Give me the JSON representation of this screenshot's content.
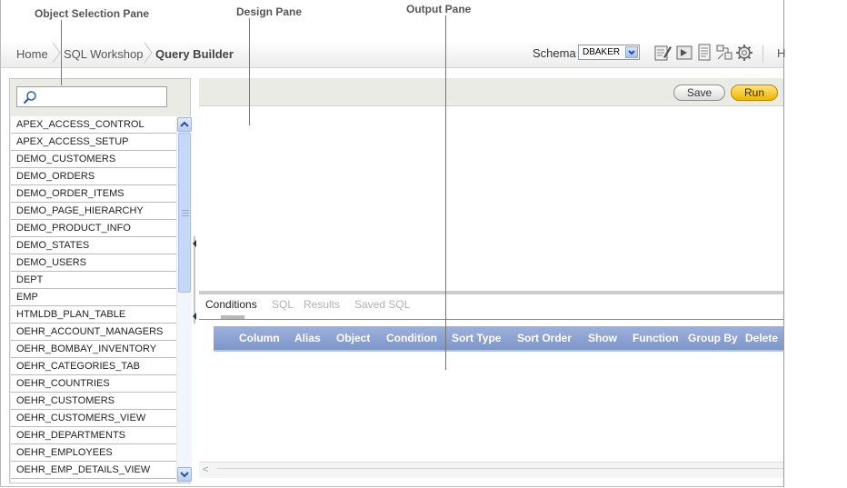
{
  "callouts": {
    "object_selection": "Object Selection Pane",
    "design": "Design Pane",
    "output": "Output Pane"
  },
  "breadcrumb": {
    "home": "Home",
    "sql_workshop": "SQL Workshop",
    "current": "Query Builder"
  },
  "toolbar": {
    "schema_label": "Schema",
    "schema_value": "DBAKER",
    "help_partial": "H",
    "icons": [
      "edit-icon",
      "sql-commands-icon",
      "scripts-icon",
      "query-builder-icon",
      "utilities-gear-icon"
    ]
  },
  "search": {
    "placeholder": "",
    "icon": "magnifier-icon"
  },
  "objects": [
    "APEX_ACCESS_CONTROL",
    "APEX_ACCESS_SETUP",
    "DEMO_CUSTOMERS",
    "DEMO_ORDERS",
    "DEMO_ORDER_ITEMS",
    "DEMO_PAGE_HIERARCHY",
    "DEMO_PRODUCT_INFO",
    "DEMO_STATES",
    "DEMO_USERS",
    "DEPT",
    "EMP",
    "HTMLDB_PLAN_TABLE",
    "OEHR_ACCOUNT_MANAGERS",
    "OEHR_BOMBAY_INVENTORY",
    "OEHR_CATEGORIES_TAB",
    "OEHR_COUNTRIES",
    "OEHR_CUSTOMERS",
    "OEHR_CUSTOMERS_VIEW",
    "OEHR_DEPARTMENTS",
    "OEHR_EMPLOYEES",
    "OEHR_EMP_DETAILS_VIEW"
  ],
  "design": {
    "save_label": "Save",
    "run_label": "Run"
  },
  "tabs": [
    "Conditions",
    "SQL",
    "Results",
    "Saved SQL"
  ],
  "columns": [
    "Column",
    "Alias",
    "Object",
    "Condition",
    "Sort Type",
    "Sort Order",
    "Show",
    "Function",
    "Group By",
    "Delete"
  ],
  "colors": {
    "run_button": "#f1b600",
    "grid_header": "#8aa0d2",
    "scroll": "#c7d7f7"
  }
}
